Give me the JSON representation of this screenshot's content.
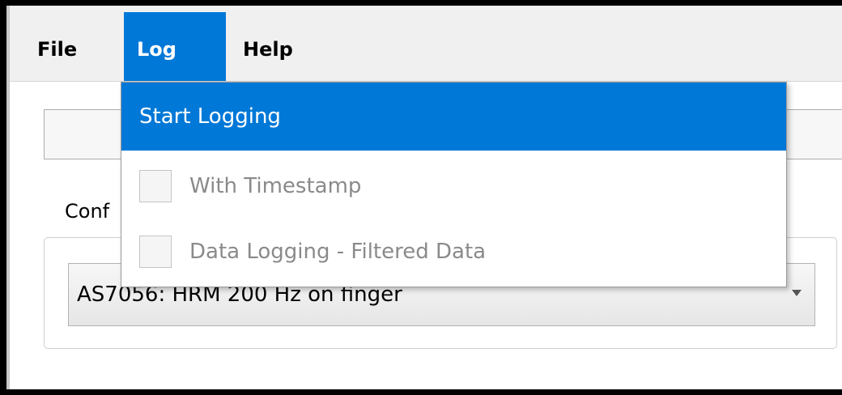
{
  "menubar": {
    "items": [
      {
        "label": "File"
      },
      {
        "label": "Log",
        "active": true
      },
      {
        "label": "Help"
      }
    ]
  },
  "log_menu": {
    "start_logging": "Start Logging",
    "with_timestamp": {
      "label": "With Timestamp",
      "checked": false,
      "enabled": false
    },
    "filtered_data": {
      "label": "Data Logging - Filtered Data",
      "checked": false,
      "enabled": false
    }
  },
  "main": {
    "config_label": "Conf",
    "config_select_value": "AS7056: HRM 200 Hz on finger"
  },
  "colors": {
    "accent": "#0078d7",
    "disabled_text": "#8a8a8a",
    "menubar_bg": "#f0f0f0"
  }
}
